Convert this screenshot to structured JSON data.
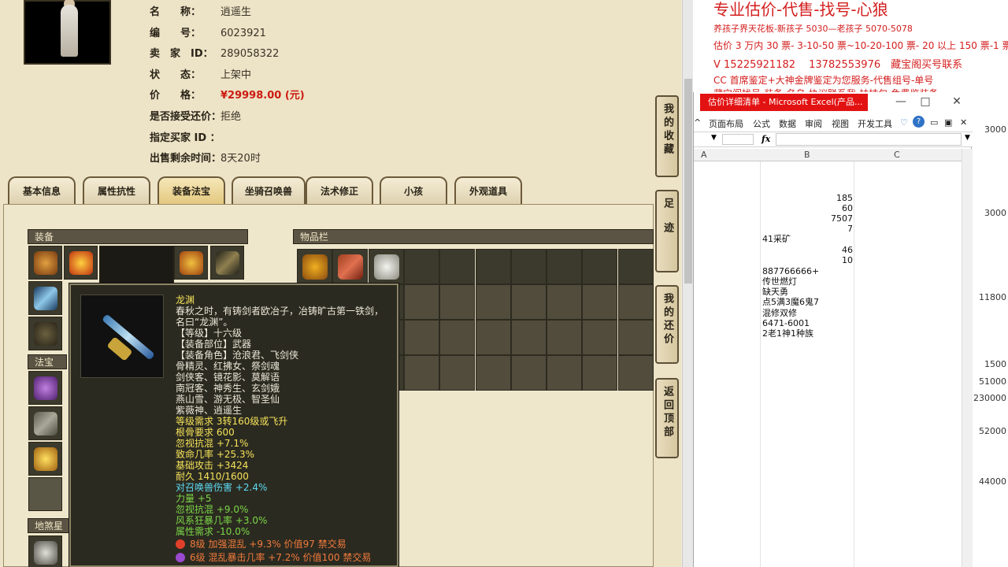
{
  "info": {
    "name_label": "名　　称：",
    "name": "逍遥生",
    "id_label": "编　　号：",
    "id": "6023921",
    "seller_label": "卖　家　ID：",
    "seller": "289058322",
    "status_label": "状　　态：",
    "status": "上架中",
    "price_label": "价　　格：",
    "price": "¥29998.00 (元)",
    "counter_label": "是否接受还价：",
    "counter": "拒绝",
    "buyer_label": "指定买家 ID ：",
    "buyer": "",
    "remain_label": "出售剩余时间：",
    "remain": "8天20时"
  },
  "tabs": [
    "基本信息",
    "属性抗性",
    "装备法宝",
    "坐骑召唤兽",
    "法术修正",
    "小孩",
    "外观道具"
  ],
  "sections": {
    "equip": "装备",
    "items": "物品栏",
    "treasure": "法宝",
    "shasha": "地煞星降"
  },
  "side_buttons": [
    "我的收藏",
    "足迹",
    "我的还价",
    "返回顶部"
  ],
  "tooltip": {
    "name": "龙渊",
    "desc1": "春秋之时，有铸剑者欧冶子，冶铸旷古第一铁剑，",
    "desc2": "名曰“龙渊”。",
    "level": "【等级】十六级",
    "part": "【装备部位】武器",
    "role": "【装备角色】沧浪君、飞剑侠",
    "r1": "骨精灵、红拂女、祭剑魂",
    "r2": "剑侠客、镜花影、莫解语",
    "r3": "南冠客、神秀生、玄剑娥",
    "r4": "燕山雪、游无极、智圣仙",
    "r5": "紫薇神、逍遥生",
    "req": "等级需求 3转160级或飞升",
    "bone": "根骨要求 600",
    "s1": "忽视抗混 +7.1%",
    "s2": "致命几率 +25.3%",
    "s3": "基础攻击 +3424",
    "s4": "耐久 1410/1600",
    "s5": "对召唤兽伤害 +2.4%",
    "s6": "力量 +5",
    "s7": "忽视抗混 +9.0%",
    "s8": "风系狂暴几率 +3.0%",
    "s9": "属性需求 -10.0%",
    "g1": "8级 加强混乱 +9.3% 价值97 禁交易",
    "g2": "6级 混乱暴击几率 +7.2% 价值100 禁交易"
  },
  "doc": {
    "l1": "专业估价-代售-找号-心狼",
    "l2": "养孩子界天花板-新孩子 5030—老孩子 5070-5078",
    "l3": "估价 3 万内 30 票- 3-10-50 票~10-20-100 票- 20 以上 150 票-1 票 1 元",
    "l4": "V 15225921182　 13782553976　藏宝阁买号联系",
    "l5": "CC 首席鉴定+大神金牌鉴定为您服务-代售组号-单号",
    "l6": "藏宝阁找号-装备-名乌-协议联系我-扶持包-免费鉴装备",
    "ticks": [
      "3000",
      "3000",
      "11800",
      "1500",
      "51000",
      "230000",
      "52000",
      "44000"
    ]
  },
  "excel": {
    "title": "估价详细清单 - Microsoft Excel(产品...",
    "ribbon": [
      "页面布局",
      "公式",
      "数据",
      "审阅",
      "视图",
      "开发工具"
    ],
    "fx": "fx",
    "cols": [
      "A",
      "B",
      "C"
    ],
    "numbers": [
      "185",
      "60",
      "7507",
      "7"
    ],
    "b_text1": "41采矿",
    "numbers2": [
      "46",
      "10"
    ],
    "b_lines": [
      "887766666+",
      "传世燃灯",
      "缺天勇",
      "点5满3魔6鬼7",
      "混修双修",
      "6471-6001",
      "2老1神1种族"
    ]
  },
  "colors": {
    "price": "#cc1a10",
    "excel_title": "#e31212",
    "doc_text": "#d41e1e"
  }
}
